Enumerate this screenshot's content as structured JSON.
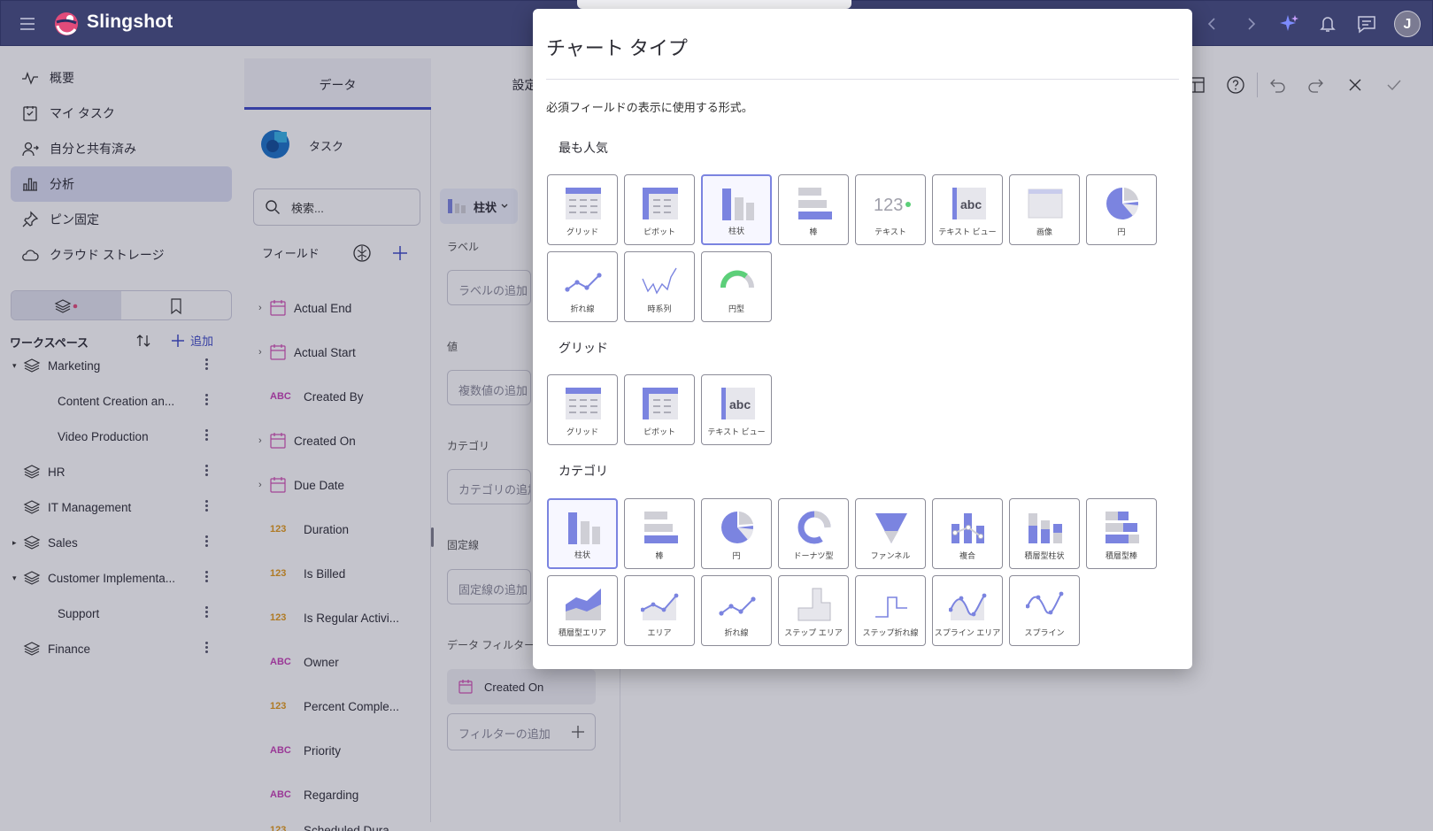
{
  "app": {
    "name": "Slingshot",
    "avatar_letter": "J"
  },
  "sidebar": {
    "nav": [
      {
        "label": "概要",
        "icon": "activity-icon"
      },
      {
        "label": "マイ タスク",
        "icon": "task-check-icon"
      },
      {
        "label": "自分と共有済み",
        "icon": "user-share-icon"
      },
      {
        "label": "分析",
        "icon": "bar-chart-icon"
      },
      {
        "label": "ピン固定",
        "icon": "pin-icon"
      },
      {
        "label": "クラウド ストレージ",
        "icon": "cloud-icon"
      }
    ],
    "workspaces_title": "ワークスペース",
    "add_label": "追加",
    "workspaces": [
      {
        "label": "Marketing",
        "expanded": true,
        "level": 0
      },
      {
        "label": "Content Creation an...",
        "level": 1
      },
      {
        "label": "Video Production",
        "level": 1
      },
      {
        "label": "HR",
        "level": 0
      },
      {
        "label": "IT Management",
        "level": 0
      },
      {
        "label": "Sales",
        "collapsed_caret": true,
        "level": 0
      },
      {
        "label": "Customer Implementa...",
        "expanded": true,
        "level": 0
      },
      {
        "label": "Support",
        "level": 1
      },
      {
        "label": "Finance",
        "level": 0
      }
    ]
  },
  "editor": {
    "tabs": [
      "データ",
      "設定"
    ],
    "source_name": "タスク",
    "search_placeholder": "検索...",
    "fields_title": "フィールド",
    "fields": [
      {
        "type": "date",
        "label": "Actual End"
      },
      {
        "type": "date",
        "label": "Actual Start"
      },
      {
        "type": "ABC",
        "label": "Created By"
      },
      {
        "type": "date",
        "label": "Created On"
      },
      {
        "type": "date",
        "label": "Due Date"
      },
      {
        "type": "123",
        "label": "Duration"
      },
      {
        "type": "123",
        "label": "Is Billed"
      },
      {
        "type": "123",
        "label": "Is Regular Activi..."
      },
      {
        "type": "ABC",
        "label": "Owner"
      },
      {
        "type": "123",
        "label": "Percent Comple..."
      },
      {
        "type": "ABC",
        "label": "Priority"
      },
      {
        "type": "ABC",
        "label": "Regarding"
      },
      {
        "type": "123",
        "label": "Scheduled Dura..."
      }
    ],
    "chart_type_button": "柱状",
    "label_section": "ラベル",
    "label_placeholder": "ラベルの追加",
    "value_section": "値",
    "value_placeholder": "複数値の追加",
    "category_section": "カテゴリ",
    "category_placeholder": "カテゴリの追加",
    "fixed_line_section": "固定線",
    "fixed_line_placeholder": "固定線の追加",
    "filter_section": "データ フィルター",
    "filter_chip": "Created On",
    "filter_placeholder": "フィルターの追加"
  },
  "modal": {
    "title": "チャート タイプ",
    "description": "必須フィールドの表示に使用する形式。",
    "sections": [
      {
        "title": "最も人気",
        "items": [
          {
            "label": "グリッド",
            "icon": "grid-chart-icon"
          },
          {
            "label": "ピボット",
            "icon": "pivot-chart-icon"
          },
          {
            "label": "柱状",
            "icon": "column-chart-icon",
            "selected": true
          },
          {
            "label": "棒",
            "icon": "bar-chart-icon"
          },
          {
            "label": "テキスト",
            "icon": "text-kpi-icon",
            "text": "123"
          },
          {
            "label": "テキスト ビュー",
            "icon": "text-view-icon",
            "text": "abc"
          },
          {
            "label": "画像",
            "icon": "image-icon"
          },
          {
            "label": "円",
            "icon": "pie-chart-icon"
          },
          {
            "label": "折れ線",
            "icon": "line-chart-icon"
          },
          {
            "label": "時系列",
            "icon": "time-series-icon"
          },
          {
            "label": "円型",
            "icon": "gauge-icon"
          }
        ]
      },
      {
        "title": "グリッド",
        "items": [
          {
            "label": "グリッド",
            "icon": "grid-chart-icon"
          },
          {
            "label": "ピボット",
            "icon": "pivot-chart-icon"
          },
          {
            "label": "テキスト ビュー",
            "icon": "text-view-icon",
            "text": "abc"
          }
        ]
      },
      {
        "title": "カテゴリ",
        "items": [
          {
            "label": "柱状",
            "icon": "column-chart-icon",
            "selected": true
          },
          {
            "label": "棒",
            "icon": "bar-chart-icon"
          },
          {
            "label": "円",
            "icon": "pie-chart-icon"
          },
          {
            "label": "ドーナツ型",
            "icon": "doughnut-chart-icon"
          },
          {
            "label": "ファンネル",
            "icon": "funnel-chart-icon"
          },
          {
            "label": "複合",
            "icon": "composite-chart-icon"
          },
          {
            "label": "積層型柱状",
            "icon": "stacked-column-icon"
          },
          {
            "label": "積層型棒",
            "icon": "stacked-bar-icon"
          },
          {
            "label": "積層型エリア",
            "icon": "stacked-area-icon"
          },
          {
            "label": "エリア",
            "icon": "area-chart-icon"
          },
          {
            "label": "折れ線",
            "icon": "line-chart-icon"
          },
          {
            "label": "ステップ エリア",
            "icon": "step-area-icon"
          },
          {
            "label": "ステップ折れ線",
            "icon": "step-line-icon"
          },
          {
            "label": "スプライン エリア",
            "icon": "spline-area-icon"
          },
          {
            "label": "スプライン",
            "icon": "spline-icon"
          }
        ]
      }
    ]
  },
  "colors": {
    "accent": "#3d49c7",
    "topbar": "#3c4170",
    "chart_blue": "#7b84e0",
    "chart_gray": "#cfcfd6"
  }
}
